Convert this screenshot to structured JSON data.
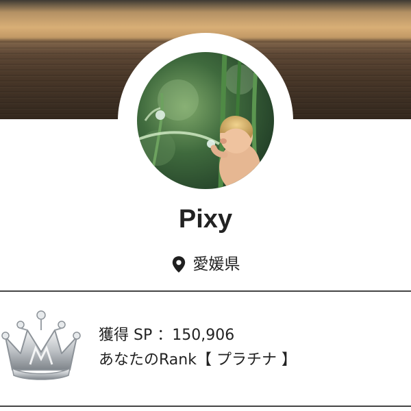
{
  "profile": {
    "name": "Pixy",
    "location": "愛媛県"
  },
  "stats": {
    "sp_label": "獲得 SP",
    "sp_separator": "：",
    "sp_value": "150,906",
    "rank_label": "あなたのRank",
    "rank_open": "【",
    "rank_value": "プラチナ",
    "rank_close": "】"
  },
  "icons": {
    "location": "map-pin-icon",
    "rank_badge": "crown-icon"
  },
  "colors": {
    "text": "#222222",
    "divider": "#444444",
    "crown_silver": "#bfc3c7"
  }
}
